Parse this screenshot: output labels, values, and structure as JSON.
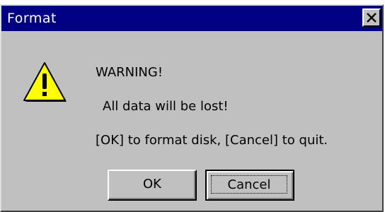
{
  "window": {
    "title": "Format",
    "close_glyph": "X"
  },
  "message": {
    "line1": "WARNING!",
    "line2": "All data will be lost!",
    "line3": "[OK] to format disk, [Cancel] to quit."
  },
  "buttons": {
    "ok_label": "OK",
    "cancel_label": "Cancel"
  },
  "icons": {
    "warning": "warning-icon",
    "close": "close-icon"
  },
  "colors": {
    "titlebar": "#000080",
    "face": "#c0c0c0",
    "warning_yellow": "#ffff00"
  }
}
